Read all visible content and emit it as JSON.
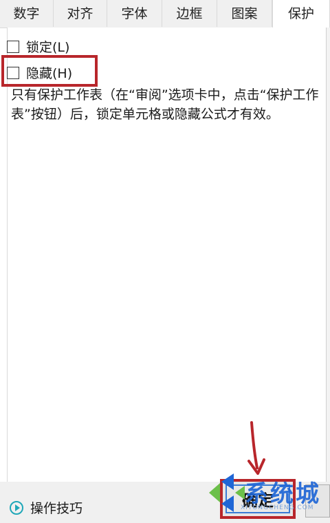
{
  "tabs": [
    {
      "label": "数字",
      "active": false
    },
    {
      "label": "对齐",
      "active": false
    },
    {
      "label": "字体",
      "active": false
    },
    {
      "label": "边框",
      "active": false
    },
    {
      "label": "图案",
      "active": false
    },
    {
      "label": "保护",
      "active": true
    }
  ],
  "protection": {
    "locked_label": "锁定(L)",
    "locked_checked": false,
    "hidden_label": "隐藏(H)",
    "hidden_checked": false,
    "description_line1": "只有保护工作表（在“审阅”选项卡中，点击“保护工作",
    "description_line2": "表”按钮）后，锁定单元格或隐藏公式才有效。"
  },
  "footer": {
    "tips_label": "操作技巧",
    "ok_label": "确定"
  },
  "watermark": {
    "text": "系统城",
    "url": "XITONGCHENG.COM"
  },
  "colors": {
    "highlight": "#b8262b",
    "watermark_blue": "#1f66d6",
    "watermark_green": "#6cc04a",
    "tips_accent": "#1fa7b8"
  }
}
